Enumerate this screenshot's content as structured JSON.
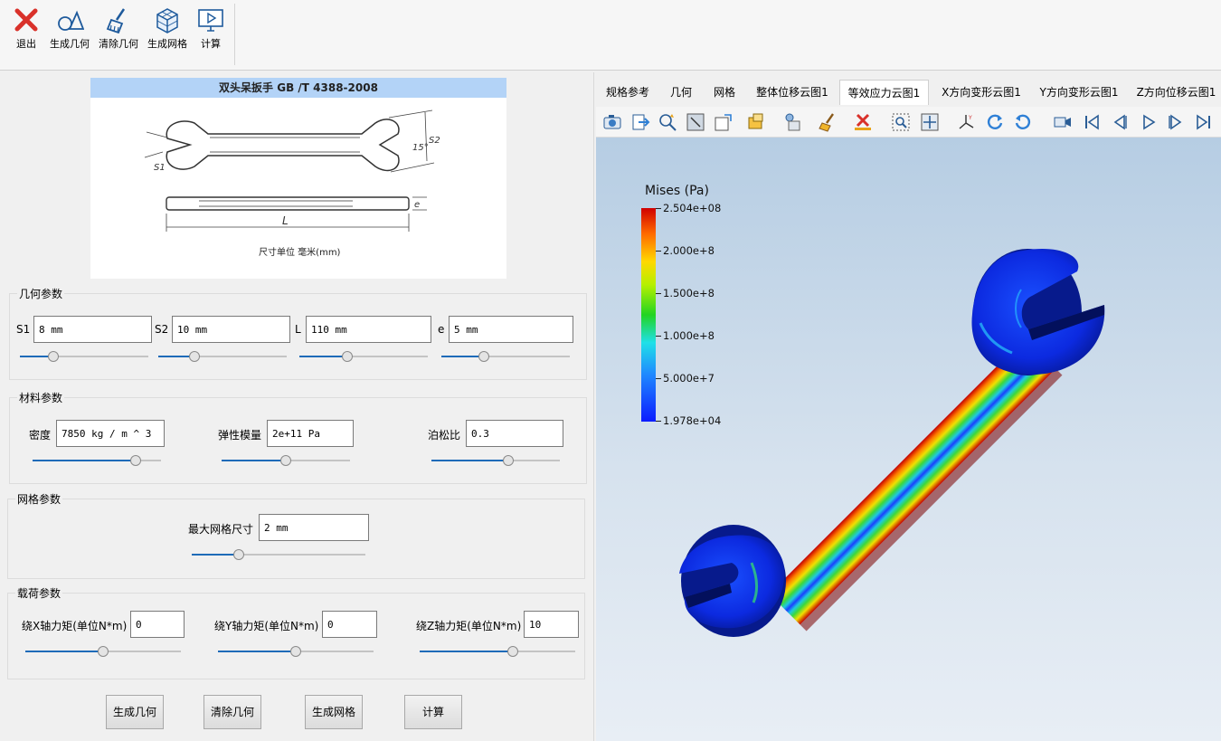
{
  "toolbar": {
    "items": [
      {
        "label": "退出",
        "icon": "exit-icon"
      },
      {
        "label": "生成几何",
        "icon": "shapes-icon"
      },
      {
        "label": "清除几何",
        "icon": "brush-icon"
      },
      {
        "label": "生成网格",
        "icon": "mesh-cube-icon"
      },
      {
        "label": "计算",
        "icon": "compute-monitor-icon"
      }
    ]
  },
  "diagram": {
    "title": "双头呆扳手 GB /T 4388-2008",
    "caption": "尺寸单位 毫米(mm)",
    "labels": {
      "s1": "S1",
      "s2": "S2",
      "angle": "15°",
      "l": "L",
      "e": "e"
    }
  },
  "geometry": {
    "title": "几何参数",
    "fields": [
      {
        "label": "S1",
        "value": "8 mm",
        "slider": 0.26
      },
      {
        "label": "S2",
        "value": "10 mm",
        "slider": 0.28
      },
      {
        "label": "L",
        "value": "110 mm",
        "slider": 0.37
      },
      {
        "label": "e",
        "value": "5 mm",
        "slider": 0.33
      }
    ]
  },
  "material": {
    "title": "材料参数",
    "fields": [
      {
        "label": "密度",
        "value": "7850 kg / m ^ 3",
        "slider": 0.8
      },
      {
        "label": "弹性模量",
        "value": "2e+11 Pa",
        "slider": 0.5
      },
      {
        "label": "泊松比",
        "value": "0.3",
        "slider": 0.6
      }
    ]
  },
  "mesh": {
    "title": "网格参数",
    "field": {
      "label": "最大网格尺寸",
      "value": "2 mm",
      "slider": 0.27
    }
  },
  "load": {
    "title": "载荷参数",
    "fields": [
      {
        "label": "绕X轴力矩(单位N*m)",
        "value": "0",
        "slider": 0.5
      },
      {
        "label": "绕Y轴力矩(单位N*m)",
        "value": "0",
        "slider": 0.5
      },
      {
        "label": "绕Z轴力矩(单位N*m)",
        "value": "10",
        "slider": 0.6
      }
    ]
  },
  "buttons": [
    "生成几何",
    "清除几何",
    "生成网格",
    "计算"
  ],
  "tabs": [
    {
      "label": "规格参考",
      "active": false
    },
    {
      "label": "几何",
      "active": false
    },
    {
      "label": "网格",
      "active": false
    },
    {
      "label": "整体位移云图1",
      "active": false
    },
    {
      "label": "等效应力云图1",
      "active": true
    },
    {
      "label": "X方向变形云图1",
      "active": false
    },
    {
      "label": "Y方向变形云图1",
      "active": false
    },
    {
      "label": "Z方向位移云图1",
      "active": false
    }
  ],
  "viewer_toolbar": {
    "icons": [
      "camera-icon",
      "export-icon",
      "zoom-select-icon",
      "fit-icon",
      "box-icon",
      "color-icon",
      "display-icon",
      "clean-icon",
      "clear-icon",
      "zoom-box-icon",
      "pan-icon",
      "axes-icon",
      "rotate-cw-icon",
      "rotate-ccw-icon",
      "video-icon",
      "first-frame-icon",
      "prev-frame-icon",
      "play-icon",
      "next-frame-icon",
      "last-frame-icon"
    ]
  },
  "legend": {
    "title": "Mises (Pa)",
    "ticks": [
      "2.504e+08",
      "2.000e+8",
      "1.500e+8",
      "1.000e+8",
      "5.000e+7",
      "1.978e+04"
    ],
    "colors": {
      "max": "#d00000",
      "mid": "#22d422",
      "min": "#0c1cff"
    }
  }
}
